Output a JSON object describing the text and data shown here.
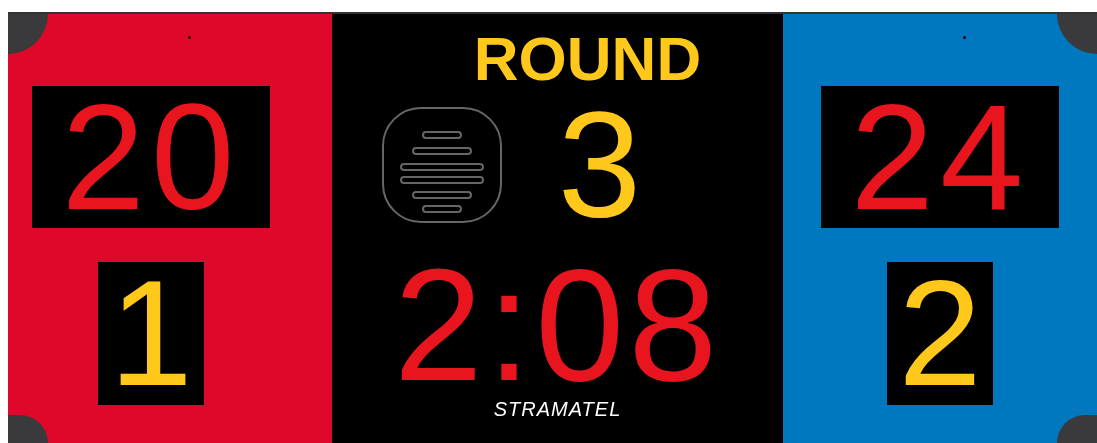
{
  "round_label": "ROUND",
  "round": "3",
  "clock": "2:08",
  "brand": "STRAMATEL",
  "teams": [
    {
      "color": "#e0082a",
      "score": "20",
      "period_score": "1"
    },
    {
      "color": "#0078c0",
      "score": "24",
      "period_score": "2"
    }
  ]
}
